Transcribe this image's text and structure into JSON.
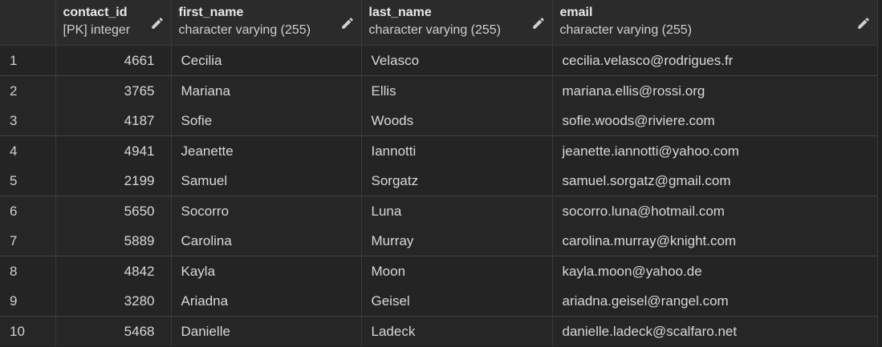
{
  "columns": [
    {
      "name": "contact_id",
      "type": "[PK] integer"
    },
    {
      "name": "first_name",
      "type": "character varying (255)"
    },
    {
      "name": "last_name",
      "type": "character varying (255)"
    },
    {
      "name": "email",
      "type": "character varying (255)"
    }
  ],
  "rows": [
    {
      "n": "1",
      "contact_id": "4661",
      "first_name": "Cecilia",
      "last_name": "Velasco",
      "email": "cecilia.velasco@rodrigues.fr"
    },
    {
      "n": "2",
      "contact_id": "3765",
      "first_name": "Mariana",
      "last_name": "Ellis",
      "email": "mariana.ellis@rossi.org"
    },
    {
      "n": "3",
      "contact_id": "4187",
      "first_name": "Sofie",
      "last_name": "Woods",
      "email": "sofie.woods@riviere.com"
    },
    {
      "n": "4",
      "contact_id": "4941",
      "first_name": "Jeanette",
      "last_name": "Iannotti",
      "email": "jeanette.iannotti@yahoo.com"
    },
    {
      "n": "5",
      "contact_id": "2199",
      "first_name": "Samuel",
      "last_name": "Sorgatz",
      "email": "samuel.sorgatz@gmail.com"
    },
    {
      "n": "6",
      "contact_id": "5650",
      "first_name": "Socorro",
      "last_name": "Luna",
      "email": "socorro.luna@hotmail.com"
    },
    {
      "n": "7",
      "contact_id": "5889",
      "first_name": "Carolina",
      "last_name": "Murray",
      "email": "carolina.murray@knight.com"
    },
    {
      "n": "8",
      "contact_id": "4842",
      "first_name": "Kayla",
      "last_name": "Moon",
      "email": "kayla.moon@yahoo.de"
    },
    {
      "n": "9",
      "contact_id": "3280",
      "first_name": "Ariadna",
      "last_name": "Geisel",
      "email": "ariadna.geisel@rangel.com"
    },
    {
      "n": "10",
      "contact_id": "5468",
      "first_name": "Danielle",
      "last_name": "Ladeck",
      "email": "danielle.ladeck@scalfaro.net"
    }
  ]
}
